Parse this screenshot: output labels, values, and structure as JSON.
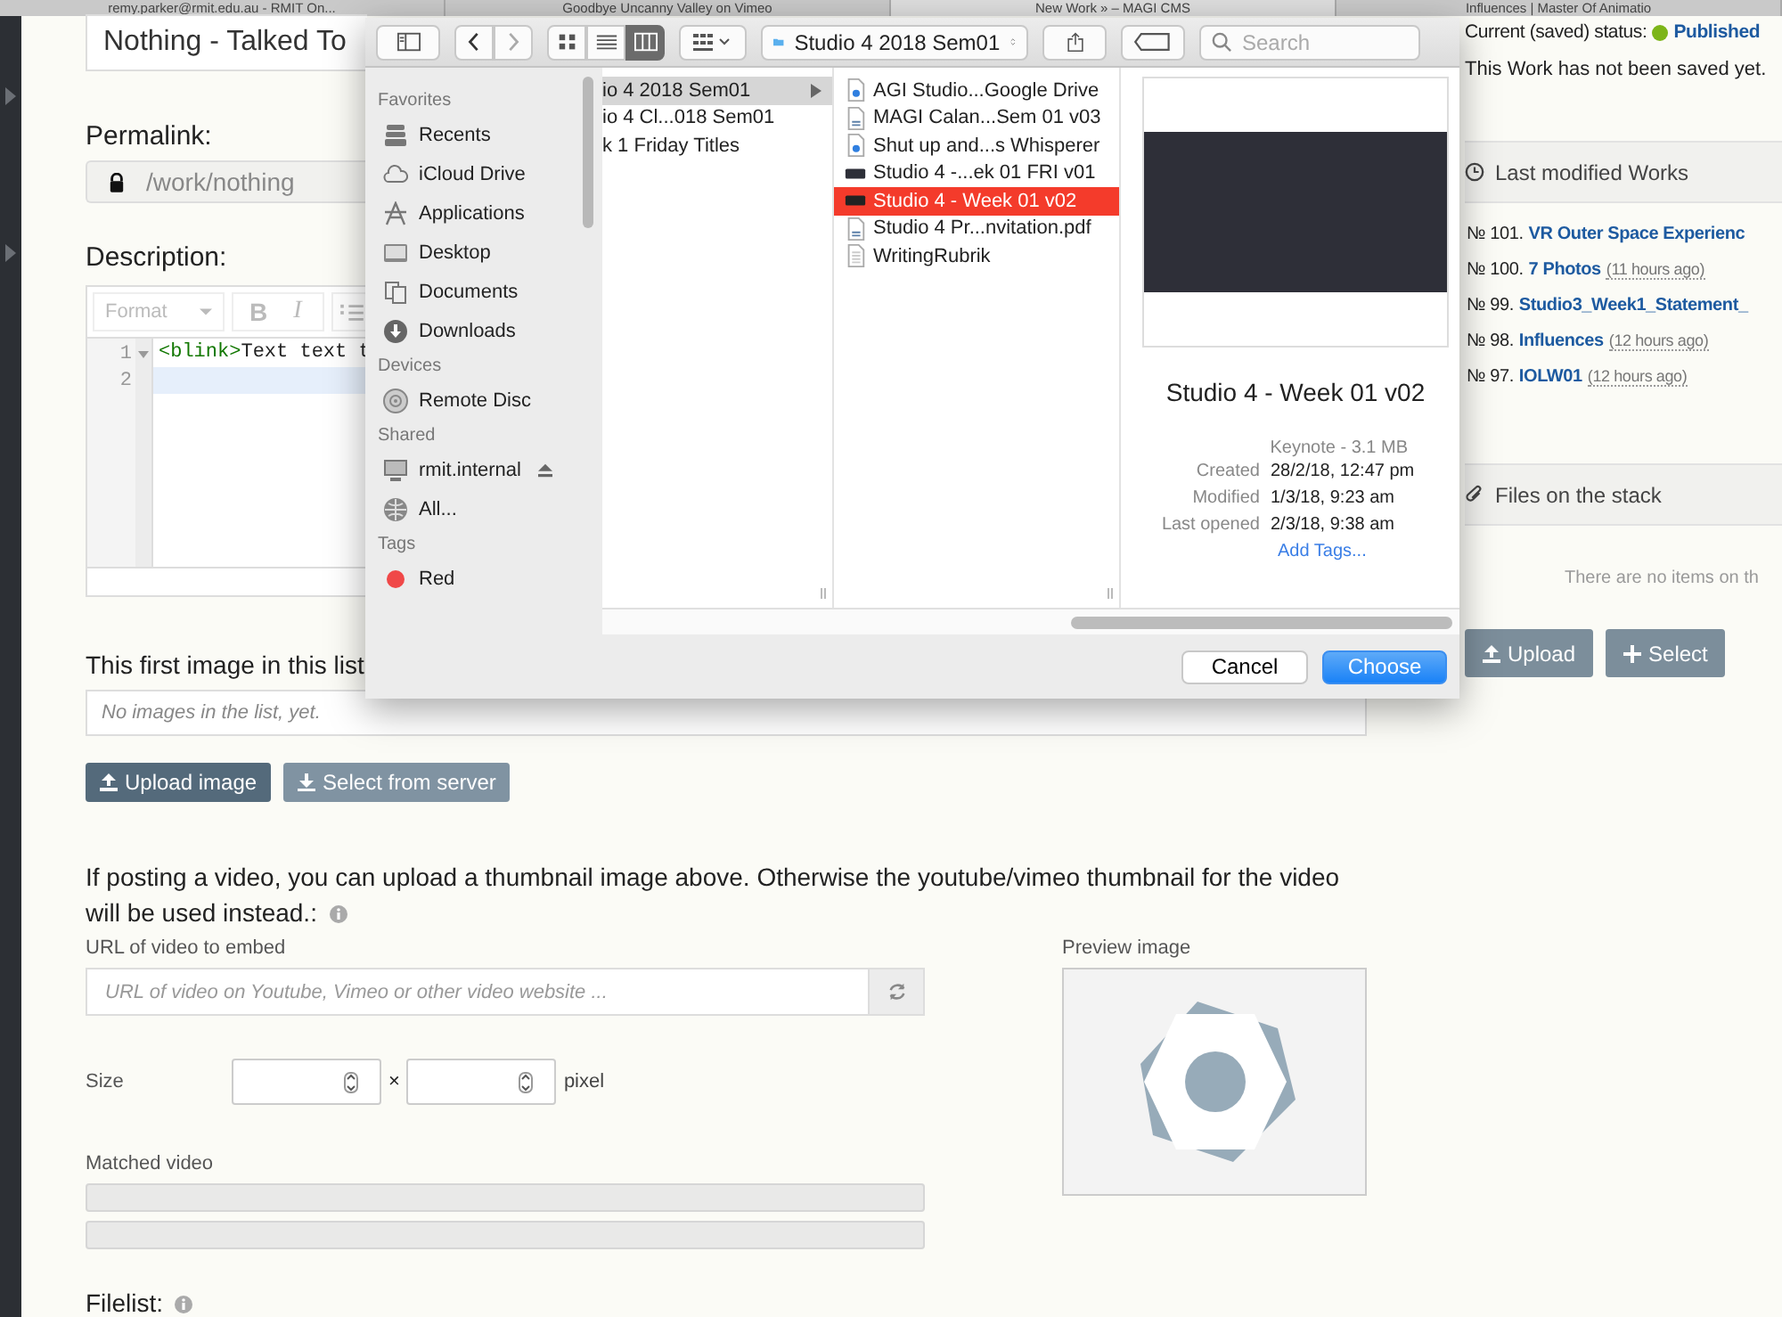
{
  "browser_tabs": [
    {
      "title": "remy.parker@rmit.edu.au - RMIT On...",
      "selected": false
    },
    {
      "title": "Goodbye Uncanny Valley on Vimeo",
      "selected": false
    },
    {
      "title": "New Work » – MAGI CMS",
      "selected": true
    },
    {
      "title": "Influences | Master Of Animatio",
      "selected": false
    }
  ],
  "page": {
    "title_value": "Nothing - Talked To",
    "permalink_label": "Permalink:",
    "permalink_value": "/work/nothing",
    "description_label": "Description:",
    "editor_toolbar": {
      "format": "Format",
      "buttons": [
        "B",
        "I"
      ]
    },
    "editor_lines": [
      {
        "number": "1",
        "tag": "<blink>",
        "text": "Text text t",
        "foldable": true,
        "active": false
      },
      {
        "number": "2",
        "foldable": false,
        "active": true
      }
    ],
    "images_label": "This first image in this list",
    "images_empty": "No images in the list, yet.",
    "image_buttons": [
      {
        "label": "Upload image",
        "kind": "upload"
      },
      {
        "label": "Select from server",
        "kind": "select"
      }
    ],
    "video_note": "If posting a video, you can upload a thumbnail image above. Otherwise the youtube/vimeo thumbnail for the video will be used instead.:",
    "url_label": "URL of video to embed",
    "url_placeholder": "URL of video on Youtube, Vimeo or other video website ...",
    "size_label": "Size",
    "size_separator": "×",
    "size_unit": "pixel",
    "matched_label": "Matched video",
    "preview_label": "Preview image",
    "filelist_label": "Filelist:"
  },
  "sidebar": {
    "status_label": "Current (saved) status:",
    "status": "Published",
    "save_note": "This Work has not been saved yet.",
    "recent_title": "Last modified Works",
    "recent": [
      {
        "number": "№ 101.",
        "title": "VR Outer Space Experienc"
      },
      {
        "number": "№ 100.",
        "title": "7 Photos",
        "age": "(11 hours ago)"
      },
      {
        "number": "№ 99.",
        "title": "Studio3_Week1_Statement_"
      },
      {
        "number": "№ 98.",
        "title": "Influences",
        "age": "(12 hours ago)"
      },
      {
        "number": "№ 97.",
        "title": "IOLW01",
        "age": "(12 hours ago)"
      }
    ],
    "stack_title": "Files on the stack",
    "stack_empty": "There are no items on th",
    "stack_buttons": [
      {
        "label": "Upload",
        "kind": "upload"
      },
      {
        "label": "Select",
        "kind": "plus"
      }
    ]
  },
  "dialog": {
    "path": "Studio 4 2018 Sem01",
    "search_placeholder": "Search",
    "view_modes": [
      {
        "kind": "icons",
        "selected": false
      },
      {
        "kind": "list",
        "selected": false
      },
      {
        "kind": "columns",
        "selected": true
      }
    ],
    "sections": [
      {
        "heading": "Favorites",
        "items": [
          {
            "label": "Recents",
            "kind": "recents",
            "eject": false
          },
          {
            "label": "iCloud Drive",
            "kind": "cloud",
            "eject": false
          },
          {
            "label": "Applications",
            "kind": "apps",
            "eject": false
          },
          {
            "label": "Desktop",
            "kind": "desktop",
            "eject": false
          },
          {
            "label": "Documents",
            "kind": "documents",
            "eject": false
          },
          {
            "label": "Downloads",
            "kind": "downloads",
            "eject": false
          }
        ]
      },
      {
        "heading": "Devices",
        "items": [
          {
            "label": "Remote Disc",
            "kind": "disc",
            "eject": false
          }
        ]
      },
      {
        "heading": "Shared",
        "items": [
          {
            "label": "rmit.internal",
            "kind": "server",
            "eject": true
          },
          {
            "label": "All...",
            "kind": "network",
            "eject": false
          }
        ]
      },
      {
        "heading": "Tags",
        "items": [
          {
            "label": "Red",
            "kind": "tag",
            "color": "#f04848",
            "eject": false
          }
        ]
      }
    ],
    "column_1": [
      {
        "name": "io 4 2018 Sem01",
        "kind": "folder",
        "selected": true
      },
      {
        "name": "io 4 Cl...018 Sem01",
        "kind": "file",
        "selected": false
      },
      {
        "name": "k 1 Friday Titles",
        "kind": "file",
        "selected": false
      }
    ],
    "column_2": [
      {
        "name": "AGI Studio...Google Drive",
        "kind": "gdoc",
        "selected": false
      },
      {
        "name": "MAGI Calan...Sem 01 v03",
        "kind": "pdf",
        "selected": false
      },
      {
        "name": "Shut up and...s Whisperer",
        "kind": "gdoc",
        "selected": false
      },
      {
        "name": "Studio 4 -...ek 01 FRI v01",
        "kind": "keynote",
        "selected": false
      },
      {
        "name": "Studio 4 - Week 01 v02",
        "kind": "keynote",
        "selected": true
      },
      {
        "name": "Studio 4 Pr...nvitation.pdf",
        "kind": "pdf",
        "selected": false
      },
      {
        "name": "WritingRubrik",
        "kind": "text",
        "selected": false
      }
    ],
    "preview": {
      "name": "Studio 4 - Week 01 v02",
      "kind_size": "Keynote - 3.1 MB",
      "meta": [
        {
          "label": "Created",
          "value": "28/2/18, 12:47 pm"
        },
        {
          "label": "Modified",
          "value": "1/3/18, 9:23 am"
        },
        {
          "label": "Last opened",
          "value": "2/3/18, 9:38 am"
        }
      ],
      "add_tags": "Add Tags..."
    },
    "buttons": [
      {
        "label": "Cancel",
        "kind": "default"
      },
      {
        "label": "Choose",
        "kind": "primary"
      }
    ]
  }
}
